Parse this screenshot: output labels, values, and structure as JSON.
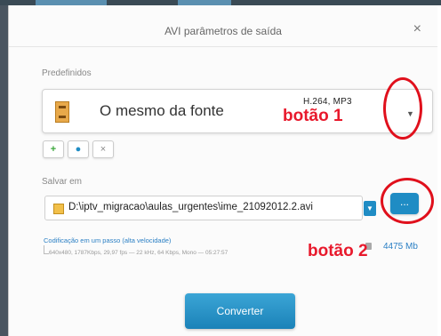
{
  "window": {
    "title": "AVI parâmetros de saída",
    "close_label": "×"
  },
  "presets": {
    "label": "Predefinidos",
    "selected": "O mesmo da fonte",
    "codec": "H.264, MP3",
    "codec_sub": "",
    "dropdown_label": "▼"
  },
  "preset_buttons": [
    {
      "name": "add",
      "label": "+",
      "color": "#3aa63a"
    },
    {
      "name": "settings",
      "label": "●",
      "color": "#1f8cc4"
    },
    {
      "name": "remove",
      "label": "×",
      "color": "#888888"
    }
  ],
  "save": {
    "label": "Salvar em",
    "path": "D:\\iptv_migracao\\aulas_urgentes\\ime_21092012.2.avi",
    "dropdown_label": "▼",
    "browse_label": "..."
  },
  "encoding": {
    "mode": "Codificação em um passo (alta velocidade)",
    "detail": "640x480, 1787Kbps, 29,97 fps — 22 kHz, 64 Kbps, Mono — 05:27:57",
    "size": "4475 Mb"
  },
  "convert_label": "Converter",
  "annotations": {
    "button1": "botão 1",
    "button2": "botão 2",
    "color": "#e8192c"
  }
}
